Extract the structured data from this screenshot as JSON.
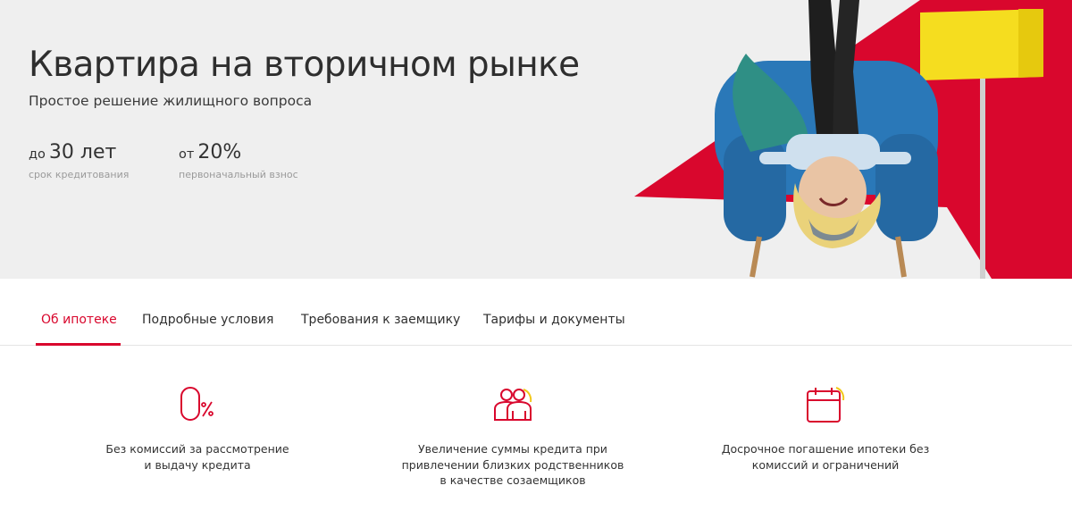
{
  "hero": {
    "title": "Квартира на вторичном рынке",
    "subtitle": "Простое решение жилищного вопроса",
    "stats": [
      {
        "prefix": "до",
        "value": "30 лет",
        "label": "срок кредитования"
      },
      {
        "prefix": "от",
        "value": "20%",
        "label": "первоначальный взнос"
      }
    ]
  },
  "tabs": [
    {
      "label": "Об ипотеке",
      "active": true
    },
    {
      "label": "Подробные условия",
      "active": false
    },
    {
      "label": "Требования к заемщику",
      "active": false
    },
    {
      "label": "Тарифы и документы",
      "active": false
    }
  ],
  "features": [
    {
      "icon": "zero-percent-icon",
      "text": "Без комиссий за рассмотрение\nи выдачу кредита"
    },
    {
      "icon": "co-borrowers-icon",
      "text": "Увеличение суммы кредита при\nпривлечении близких родственников\nв качестве созаемщиков"
    },
    {
      "icon": "calendar-icon",
      "text": "Досрочное погашение ипотеки без\nкомиссий и ограничений"
    }
  ],
  "colors": {
    "accent": "#d9072d",
    "hero_bg": "#efefef",
    "chair": "#2a78b8",
    "lamp": "#f5dd1f"
  }
}
